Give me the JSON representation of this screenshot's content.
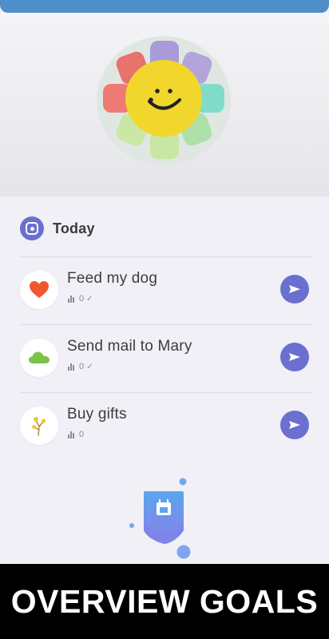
{
  "colors": {
    "accent": "#6a6fd0",
    "top_bar": "#4f8fc9",
    "background": "#f0f0f6",
    "heart": "#f0572d",
    "cloud": "#7cc24a",
    "caption_bg": "#000000"
  },
  "hero": {
    "mascot_icon": "smiling-flower-icon"
  },
  "section": {
    "label": "Today",
    "icon": "today-calendar-icon"
  },
  "goals": [
    {
      "title": "Feed my dog",
      "count": "0",
      "checked": true,
      "icon": "heart-icon"
    },
    {
      "title": "Send mail to Mary",
      "count": "0",
      "checked": true,
      "icon": "cloud-icon"
    },
    {
      "title": "Buy gifts",
      "count": "0",
      "checked": false,
      "icon": "flower-branch-icon"
    }
  ],
  "bottom": {
    "icon": "calendar-badge-icon"
  },
  "caption": {
    "text": "OVERVIEW GOALS"
  }
}
